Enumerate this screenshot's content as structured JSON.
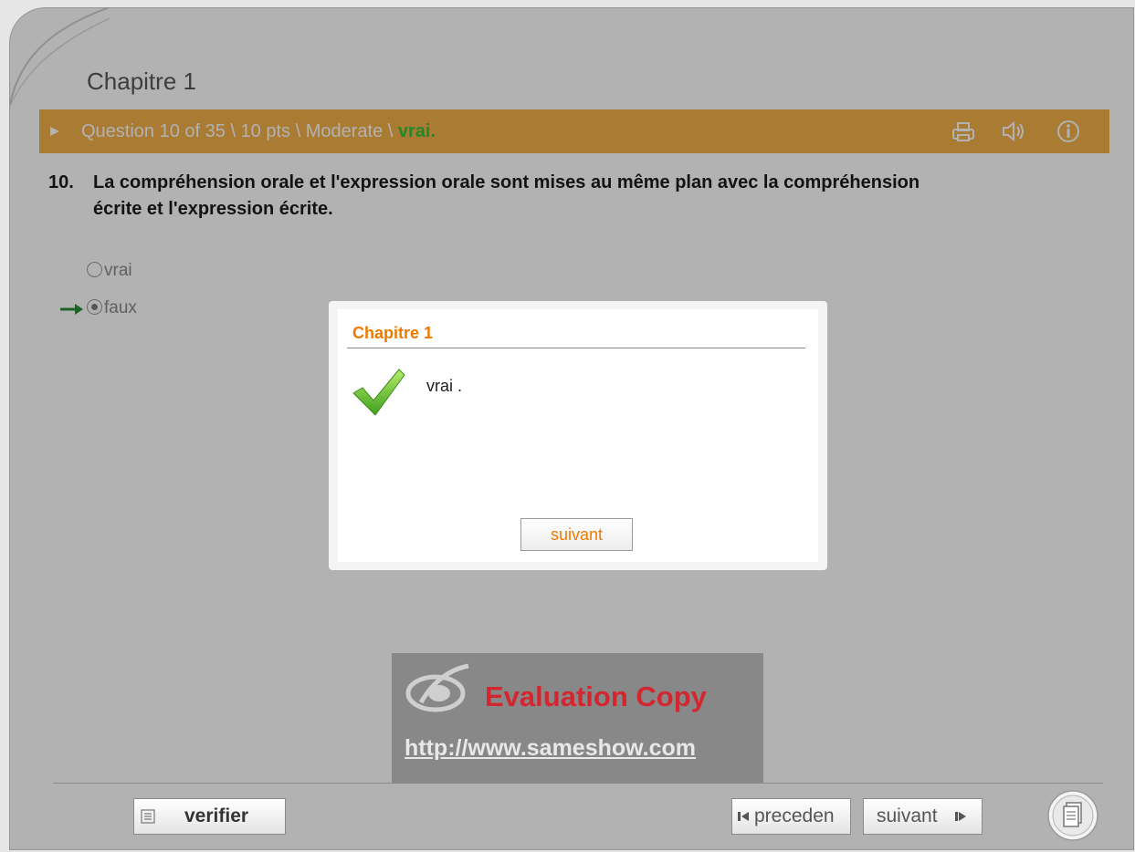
{
  "chapter": {
    "title": "Chapitre 1"
  },
  "question_bar": {
    "info": "Question 10 of 35 \\ 10 pts \\ Moderate \\ ",
    "status": "vrai.",
    "status_color": "#36c236",
    "bar_color": "#f2b04a",
    "icons": [
      "printer-icon",
      "speaker-icon",
      "info-icon"
    ]
  },
  "question": {
    "number": "10.",
    "text": "La compréhension orale et l'expression orale sont mises au même plan avec la compréhension écrite et l'expression écrite."
  },
  "options": [
    {
      "label": "vrai",
      "selected": false
    },
    {
      "label": "faux",
      "selected": true
    }
  ],
  "dialog": {
    "title": "Chapitre 1",
    "message": "vrai .",
    "button_label": "suivant",
    "accent_color": "#ee7a00"
  },
  "watermark": {
    "title": "Evaluation Copy",
    "url": "http://www.sameshow.com"
  },
  "footer": {
    "verify_label": "verifier",
    "prev_label": "preceden",
    "next_label": "suivant"
  }
}
